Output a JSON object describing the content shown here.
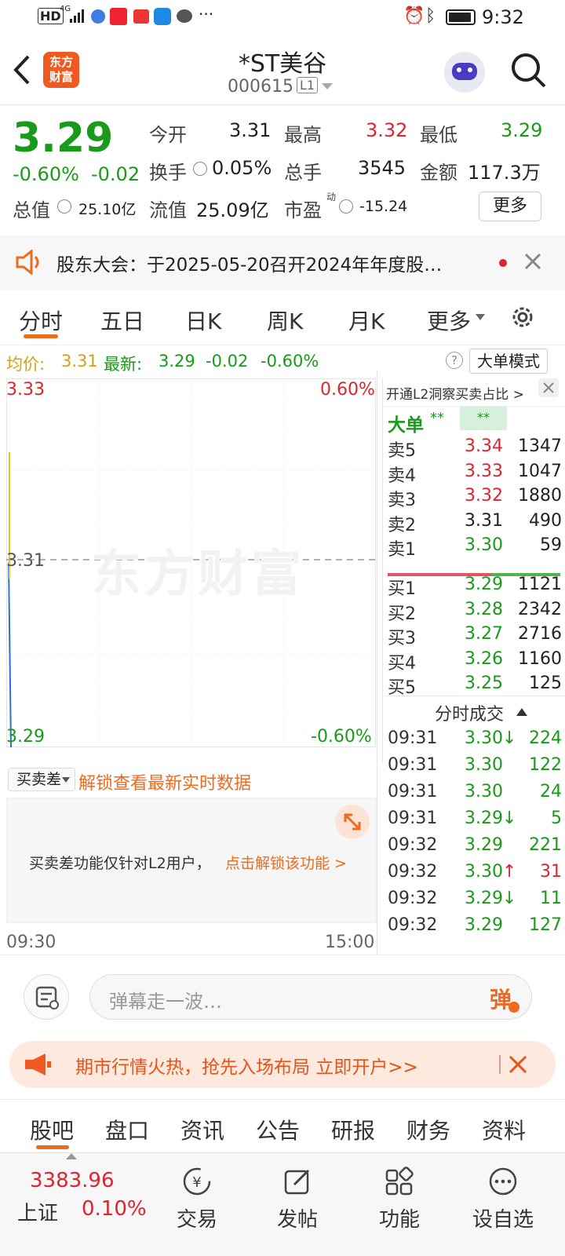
{
  "status": {
    "left": "HD",
    "net": "4G",
    "time": "9:32"
  },
  "header": {
    "back": "<",
    "logo_line1": "东方",
    "logo_line2": "财富",
    "name": "*ST美谷",
    "code": "000615",
    "level": "L1"
  },
  "quote": {
    "price": "3.29",
    "change_pct": "-0.60%",
    "change": "-0.02",
    "open_label": "今开",
    "open": "3.31",
    "high_label": "最高",
    "high": "3.32",
    "low_label": "最低",
    "low": "3.29",
    "turnover_label": "换手",
    "turnover": "0.05%",
    "volume_label": "总手",
    "volume": "3545",
    "amount_label": "金额",
    "amount": "117.3万",
    "mktcap_label": "总值",
    "mktcap": "25.10亿",
    "float_label": "流值",
    "float": "25.09亿",
    "pe_label": "市盈",
    "pe_sup": "动",
    "pe": "-15.24",
    "more": "更多"
  },
  "notice": {
    "text": "股东大会：于2025-05-20召开2024年年度股…"
  },
  "tabs": [
    "分时",
    "五日",
    "日K",
    "周K",
    "月K",
    "更多"
  ],
  "avgline": {
    "avg_label": "均价:",
    "avg": "3.31",
    "last_label": "最新:",
    "last": "3.29",
    "chg": "-0.02",
    "pct": "-0.60%",
    "mode": "大单模式"
  },
  "chart": {
    "top_price": "3.33",
    "top_pct": "0.60%",
    "mid_price": "3.31",
    "bottom_price": "3.29",
    "bottom_pct": "-0.60%",
    "watermark": "东方财富"
  },
  "chart_data": {
    "type": "line",
    "title": "",
    "xlabel": "",
    "ylabel": "",
    "x": [
      "09:30",
      "09:31"
    ],
    "series": [
      {
        "name": "",
        "values": [
          3.31,
          3.29
        ]
      }
    ],
    "ylim": [
      3.29,
      3.33
    ]
  },
  "book": {
    "promo": "开通L2洞察买卖占比 >",
    "bigorder": "大单",
    "stars1": "**",
    "stars2": "**",
    "asks": [
      {
        "label": "卖5",
        "price": "3.34",
        "vol": "1347",
        "color": "red"
      },
      {
        "label": "卖4",
        "price": "3.33",
        "vol": "1047",
        "color": "red"
      },
      {
        "label": "卖3",
        "price": "3.32",
        "vol": "1880",
        "color": "red"
      },
      {
        "label": "卖2",
        "price": "3.31",
        "vol": "490",
        "color": "black"
      },
      {
        "label": "卖1",
        "price": "3.30",
        "vol": "59",
        "color": "green"
      }
    ],
    "bids": [
      {
        "label": "买1",
        "price": "3.29",
        "vol": "1121"
      },
      {
        "label": "买2",
        "price": "3.28",
        "vol": "2342"
      },
      {
        "label": "买3",
        "price": "3.27",
        "vol": "2716"
      },
      {
        "label": "买4",
        "price": "3.26",
        "vol": "1160"
      },
      {
        "label": "买5",
        "price": "3.25",
        "vol": "125"
      }
    ],
    "trades_title": "分时成交",
    "trades": [
      {
        "t": "09:31",
        "p": "3.30",
        "arrow": "↓",
        "v": "224",
        "ac": "green"
      },
      {
        "t": "09:31",
        "p": "3.30",
        "arrow": "",
        "v": "122",
        "ac": "green"
      },
      {
        "t": "09:31",
        "p": "3.30",
        "arrow": "",
        "v": "24",
        "ac": "green"
      },
      {
        "t": "09:31",
        "p": "3.29",
        "arrow": "↓",
        "v": "5",
        "ac": "green"
      },
      {
        "t": "09:32",
        "p": "3.29",
        "arrow": "",
        "v": "221",
        "ac": "green"
      },
      {
        "t": "09:32",
        "p": "3.30",
        "arrow": "↑",
        "v": "31",
        "ac": "red"
      },
      {
        "t": "09:32",
        "p": "3.29",
        "arrow": "↓",
        "v": "11",
        "ac": "green"
      },
      {
        "t": "09:32",
        "p": "3.29",
        "arrow": "",
        "v": "127",
        "ac": "green"
      }
    ]
  },
  "lower": {
    "select": "买卖差",
    "unlock": "解锁查看最新实时数据",
    "msg": "买卖差功能仅针对L2用户，",
    "link": "点击解锁该功能 >",
    "t_start": "09:30",
    "t_end": "15:00"
  },
  "comment": {
    "placeholder": "弹幕走一波…",
    "danmu": "弹"
  },
  "ad": {
    "text": "期市行情火热，抢先入场布局 立即开户>>"
  },
  "bottomtabs": [
    "股吧",
    "盘口",
    "资讯",
    "公告",
    "研报",
    "财务",
    "资料"
  ],
  "dock": {
    "index_value": "3383.96",
    "index_name": "上证",
    "index_pct": "0.10%",
    "items": [
      "交易",
      "发帖",
      "功能",
      "设自选"
    ]
  }
}
